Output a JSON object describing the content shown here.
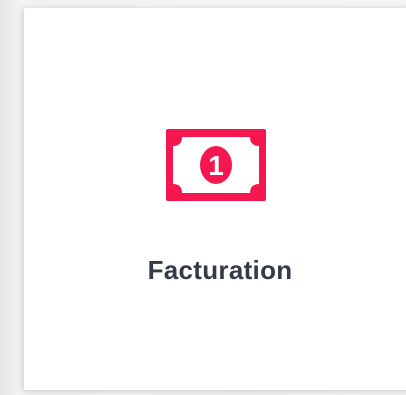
{
  "card": {
    "title": "Facturation",
    "icon": "money-bill-icon",
    "icon_numeral": "1",
    "accent_color": "#f5174f",
    "text_color": "#343b48",
    "background_color": "#ffffff"
  }
}
